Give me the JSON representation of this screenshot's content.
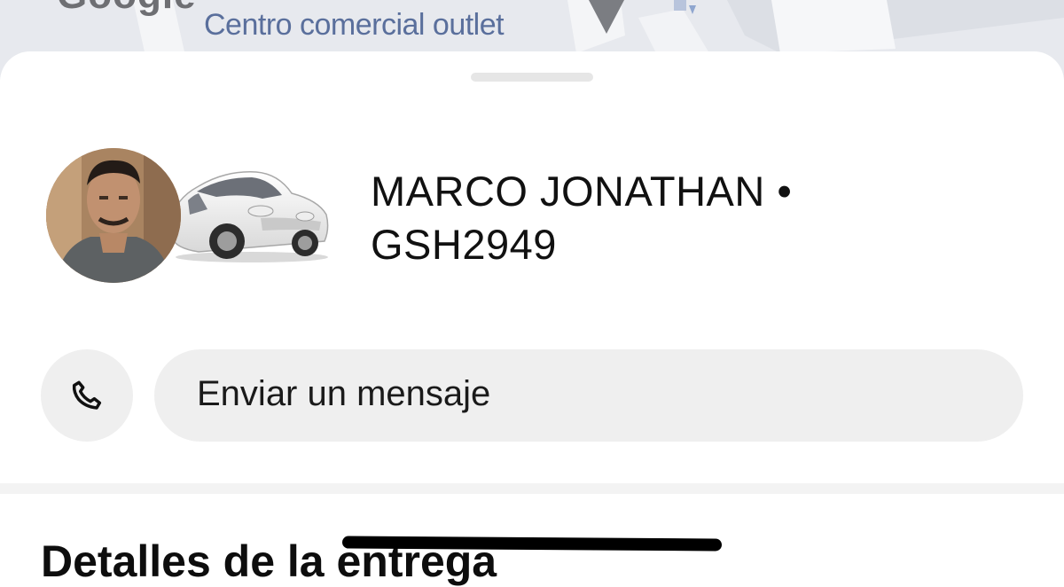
{
  "map": {
    "logo_text": "Google",
    "place_label": "Centro comercial outlet",
    "pin_icon": "map-pin-icon"
  },
  "driver": {
    "name_line": "MARCO JONATHAN •",
    "plate_line": "GSH2949",
    "avatar_icon": "driver-avatar",
    "vehicle_icon": "car-image"
  },
  "actions": {
    "call_icon": "phone-icon",
    "message_label": "Enviar un mensaje"
  },
  "section": {
    "title": "Detalles de la entrega"
  },
  "colors": {
    "button_bg": "#efefef",
    "text": "#111111",
    "map_label": "#5a6f9c"
  }
}
